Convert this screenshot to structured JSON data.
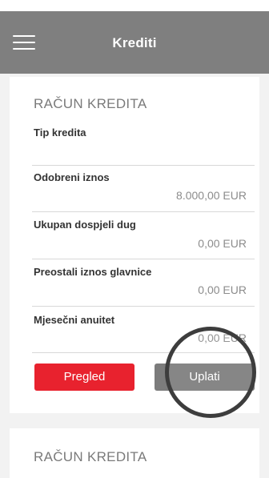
{
  "header": {
    "title": "Krediti",
    "menu_icon": "hamburger-menu-icon"
  },
  "colors": {
    "header_bg": "#7f7f7f",
    "primary_red": "#e8222e",
    "secondary_gray": "#7c7c7c"
  },
  "loan_card": {
    "heading": "RAČUN KREDITA",
    "loan_type_label": "Tip kredita",
    "rows": [
      {
        "label": "Odobreni iznos",
        "value": "8.000,00 EUR"
      },
      {
        "label": "Ukupan dospjeli dug",
        "value": "0,00 EUR"
      },
      {
        "label": "Preostali iznos glavnice",
        "value": "0,00 EUR"
      },
      {
        "label": "Mjesečni anuitet",
        "value": "0,00 EUR"
      }
    ],
    "buttons": {
      "overview": "Pregled",
      "pay": "Uplati"
    }
  },
  "second_card": {
    "heading": "RAČUN KREDITA"
  }
}
